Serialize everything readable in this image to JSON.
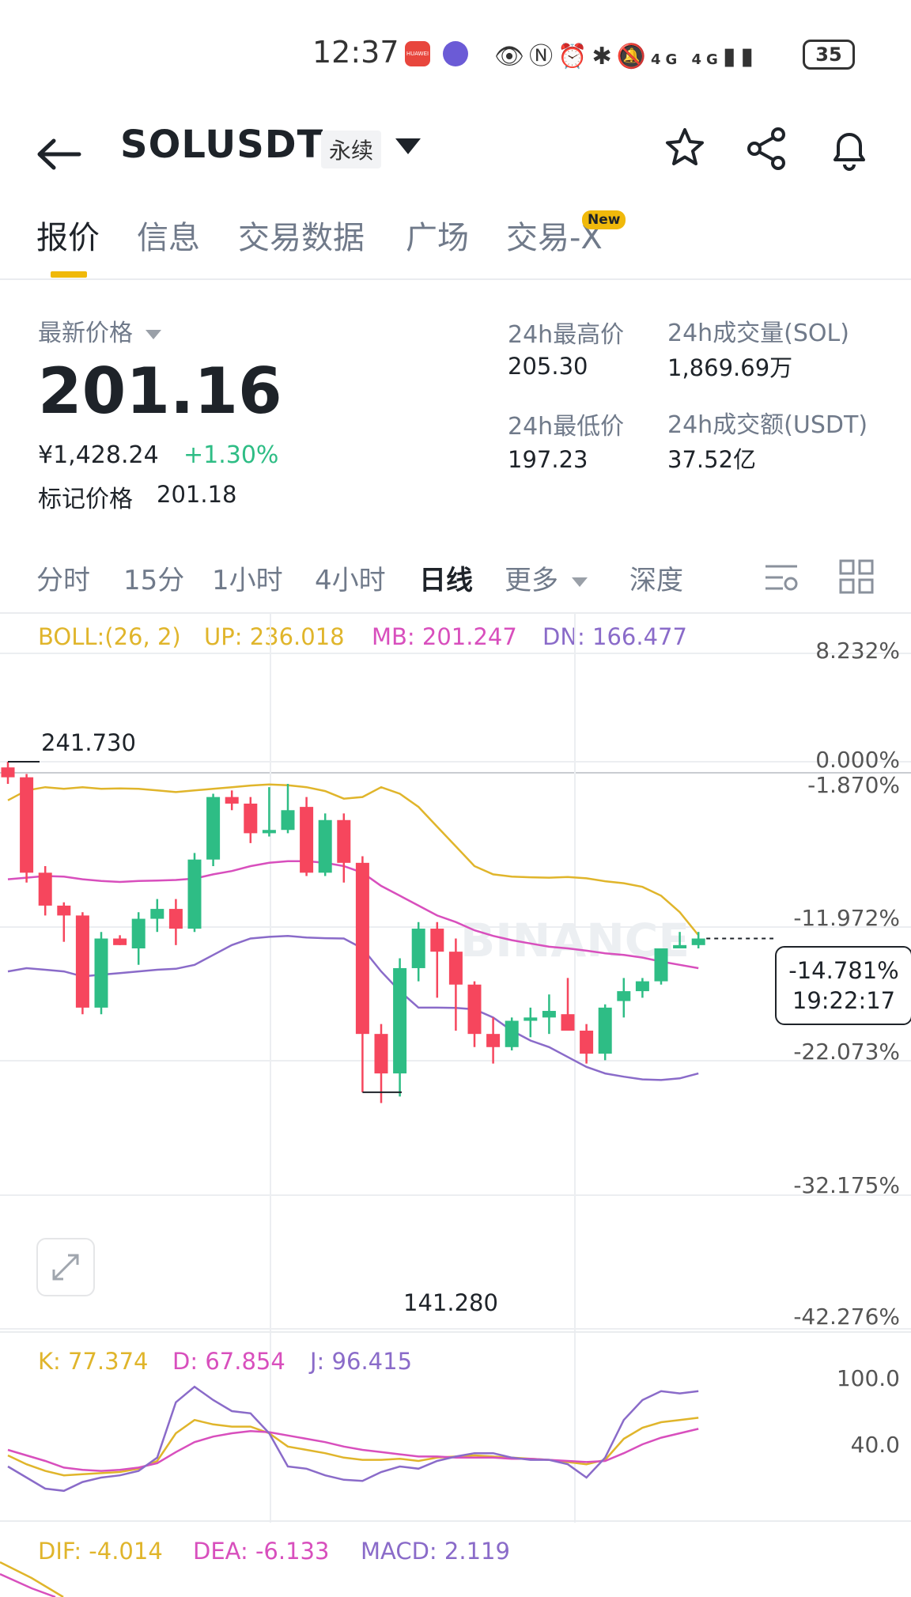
{
  "status_bar": {
    "time": "12:37",
    "battery": "35",
    "app1_label": "HUAWEI",
    "signal_text": "4G 4G"
  },
  "header": {
    "pair": "SOLUSDT",
    "badge": "永续"
  },
  "tabs": [
    {
      "label": "报价"
    },
    {
      "label": "信息"
    },
    {
      "label": "交易数据"
    },
    {
      "label": "广场"
    },
    {
      "label": "交易-X"
    }
  ],
  "new_badge": "New",
  "price": {
    "latest_label": "最新价格",
    "last": "201.16",
    "cny": "¥1,428.24",
    "change": "+1.30%",
    "mark_label": "标记价格",
    "mark": "201.18"
  },
  "stats": {
    "high_label": "24h最高价",
    "high": "205.30",
    "low_label": "24h最低价",
    "low": "197.23",
    "vol_label": "24h成交量(SOL)",
    "vol": "1,869.69万",
    "amt_label": "24h成交额(USDT)",
    "amt": "37.52亿"
  },
  "intervals": [
    {
      "label": "分时"
    },
    {
      "label": "15分"
    },
    {
      "label": "1小时"
    },
    {
      "label": "4小时"
    },
    {
      "label": "日线"
    },
    {
      "label": "更多"
    },
    {
      "label": "深度"
    }
  ],
  "boll": {
    "name": "BOLL:(26, 2)",
    "up": "UP: 236.018",
    "mb": "MB: 201.247",
    "dn": "DN: 166.477"
  },
  "axis_pct": [
    "8.232%",
    "0.000%",
    "-1.870%",
    "-11.972%",
    "-22.073%",
    "-32.175%",
    "-42.276%"
  ],
  "high_marker": "241.730",
  "low_marker": "141.280",
  "current_tag": {
    "pct": "-14.781%",
    "countdown": "19:22:17"
  },
  "watermark": "BINANCE",
  "kdj": {
    "k": "K: 77.374",
    "d": "D: 67.854",
    "j": "J: 96.415",
    "axis_top": "100.0",
    "axis_mid": "40.0"
  },
  "macd": {
    "dif": "DIF: -4.014",
    "dea": "DEA: -6.133",
    "macd": "MACD: 2.119"
  },
  "colors": {
    "up": "#2ebd85",
    "down": "#f6465d",
    "boll_up": "#e0b52b",
    "boll_mb": "#d84fbd",
    "boll_dn": "#8a6bc9",
    "accent": "#f0b90b"
  },
  "chart_data": {
    "type": "candlestick",
    "candles": [
      {
        "o": 240,
        "h": 241.73,
        "l": 235,
        "c": 237
      },
      {
        "o": 237,
        "h": 238,
        "l": 205,
        "c": 208
      },
      {
        "o": 208,
        "h": 210,
        "l": 195,
        "c": 198
      },
      {
        "o": 198,
        "h": 199,
        "l": 187,
        "c": 195
      },
      {
        "o": 195,
        "h": 196,
        "l": 165,
        "c": 167
      },
      {
        "o": 167,
        "h": 190,
        "l": 165,
        "c": 188
      },
      {
        "o": 188,
        "h": 189,
        "l": 186,
        "c": 186
      },
      {
        "o": 185,
        "h": 196,
        "l": 180,
        "c": 194
      },
      {
        "o": 194,
        "h": 200,
        "l": 190,
        "c": 197
      },
      {
        "o": 197,
        "h": 200,
        "l": 186,
        "c": 191
      },
      {
        "o": 191,
        "h": 214,
        "l": 190,
        "c": 212
      },
      {
        "o": 212,
        "h": 232,
        "l": 210,
        "c": 231
      },
      {
        "o": 231,
        "h": 233,
        "l": 227,
        "c": 229
      },
      {
        "o": 229,
        "h": 231,
        "l": 217,
        "c": 220
      },
      {
        "o": 220,
        "h": 234,
        "l": 219,
        "c": 221
      },
      {
        "o": 221,
        "h": 235,
        "l": 220,
        "c": 227
      },
      {
        "o": 228,
        "h": 231,
        "l": 207,
        "c": 208
      },
      {
        "o": 208,
        "h": 226,
        "l": 207,
        "c": 224
      },
      {
        "o": 224,
        "h": 226,
        "l": 205,
        "c": 211
      },
      {
        "o": 211,
        "h": 213,
        "l": 141.28,
        "c": 159
      },
      {
        "o": 159,
        "h": 162,
        "l": 138,
        "c": 147
      },
      {
        "o": 147,
        "h": 182,
        "l": 140,
        "c": 179
      },
      {
        "o": 179,
        "h": 193,
        "l": 175,
        "c": 191
      },
      {
        "o": 191,
        "h": 193,
        "l": 170,
        "c": 184
      },
      {
        "o": 184,
        "h": 188,
        "l": 160,
        "c": 174
      },
      {
        "o": 174,
        "h": 175,
        "l": 155,
        "c": 159
      },
      {
        "o": 159,
        "h": 164,
        "l": 150,
        "c": 155
      },
      {
        "o": 155,
        "h": 164,
        "l": 154,
        "c": 163
      },
      {
        "o": 163,
        "h": 167,
        "l": 158,
        "c": 164
      },
      {
        "o": 164,
        "h": 171,
        "l": 159,
        "c": 166
      },
      {
        "o": 165,
        "h": 176,
        "l": 160,
        "c": 160
      },
      {
        "o": 160,
        "h": 162,
        "l": 150,
        "c": 153
      },
      {
        "o": 153,
        "h": 168,
        "l": 151,
        "c": 167
      },
      {
        "o": 169,
        "h": 176,
        "l": 164,
        "c": 172
      },
      {
        "o": 172,
        "h": 176,
        "l": 170,
        "c": 175
      },
      {
        "o": 175,
        "h": 185,
        "l": 174,
        "c": 185
      },
      {
        "o": 185,
        "h": 190,
        "l": 185,
        "c": 186
      },
      {
        "o": 186,
        "h": 190,
        "l": 185,
        "c": 188
      }
    ],
    "boll_up": [
      230,
      233,
      234,
      233.5,
      234,
      233.5,
      233.6,
      233.5,
      233,
      232.5,
      233,
      233.5,
      234,
      234.5,
      234.8,
      234.6,
      234,
      232.8,
      230.5,
      231,
      234,
      232,
      228,
      222,
      216,
      210,
      207.5,
      206.8,
      206.6,
      206.5,
      206.7,
      206.3,
      205.4,
      204.8,
      203.7,
      201,
      196,
      189
    ],
    "boll_mb": [
      206,
      206.5,
      207,
      206.8,
      206,
      205.5,
      205.2,
      205.5,
      205.6,
      205.8,
      206.2,
      207.5,
      208.5,
      210,
      211,
      211.5,
      211.5,
      211,
      210,
      208,
      204,
      201,
      198,
      195,
      193,
      190.5,
      188.8,
      187.5,
      186.5,
      185.5,
      185,
      184.3,
      183.5,
      183,
      182.2,
      181,
      180,
      179
    ],
    "boll_dn": [
      178,
      179,
      178.5,
      178,
      176.5,
      177,
      177.5,
      178,
      178.5,
      178.8,
      180,
      183,
      186,
      188,
      188.5,
      188.8,
      188.3,
      188.1,
      188,
      185,
      178,
      172,
      167,
      167,
      166.9,
      166.5,
      164,
      160,
      157,
      155,
      152,
      149,
      147,
      146,
      145.2,
      145,
      145.5,
      147
    ]
  }
}
